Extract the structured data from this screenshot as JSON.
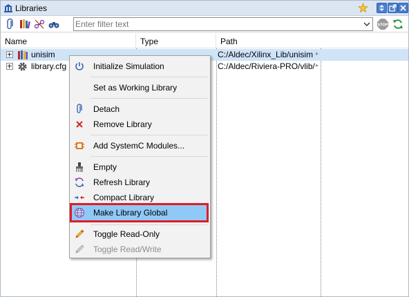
{
  "window": {
    "title": "Libraries"
  },
  "toolbar": {
    "filter_placeholder": "Enter filter text",
    "icons": [
      "attach-icon",
      "library-books-icon",
      "link-icon",
      "binoculars-icon",
      "stop-icon",
      "refresh-icon"
    ]
  },
  "table": {
    "columns": [
      "Name",
      "Type",
      "Path"
    ],
    "rows": [
      {
        "name": "unisim",
        "type": "",
        "path": "C:/Aldec/Xilinx_Lib/unisim",
        "selected": true
      },
      {
        "name": "library.cfg",
        "type": "",
        "path": "C:/Aldec/Riviera-PRO/vlib/",
        "selected": false
      }
    ]
  },
  "context_menu": {
    "items": [
      {
        "label": "Initialize Simulation",
        "icon": "power-icon",
        "enabled": true
      },
      {
        "label": "Set as Working Library",
        "icon": "",
        "enabled": true
      },
      {
        "label": "Detach",
        "icon": "paperclip-icon",
        "enabled": true
      },
      {
        "label": "Remove Library",
        "icon": "red-x-icon",
        "enabled": true
      },
      {
        "label": "Add SystemC Modules...",
        "icon": "systemc-icon",
        "enabled": true
      },
      {
        "label": "Empty",
        "icon": "broom-icon",
        "enabled": true
      },
      {
        "label": "Refresh Library",
        "icon": "refresh-icon",
        "enabled": true
      },
      {
        "label": "Compact Library",
        "icon": "compact-arrows-icon",
        "enabled": true
      },
      {
        "label": "Make Library Global",
        "icon": "globe-icon",
        "enabled": true,
        "highlighted": true
      },
      {
        "label": "Toggle Read-Only",
        "icon": "pencil-icon",
        "enabled": true
      },
      {
        "label": "Toggle Read/Write",
        "icon": "pencil-gray-icon",
        "enabled": false
      }
    ]
  },
  "colors": {
    "titlebar_bg": "#dce6f2",
    "selection_bg": "#d0e4f8",
    "menu_highlight": "#90c8f6",
    "callout_red": "#e01b24"
  }
}
